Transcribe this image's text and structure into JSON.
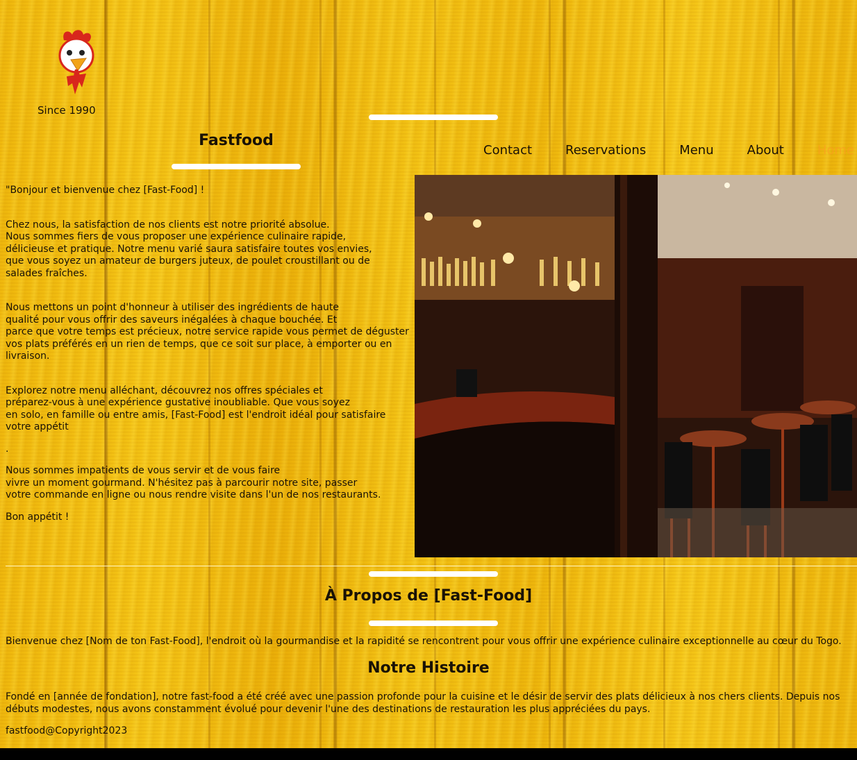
{
  "header": {
    "since": "Since 1990",
    "brand": "Fastfood"
  },
  "nav": {
    "items": [
      "Contact",
      "Reservations",
      "Menu",
      "About",
      "Home"
    ]
  },
  "intro": {
    "p1": "\"Bonjour et bienvenue chez [Fast-Food] !",
    "p2_l1": "Chez nous, la satisfaction de nos clients est notre priorité absolue.",
    "p2_l2": "Nous sommes fiers de vous proposer une expérience culinaire rapide,",
    "p2_l3": "délicieuse et pratique. Notre menu varié saura satisfaire toutes vos envies,",
    "p2_l4": "que vous soyez un amateur de burgers juteux, de poulet croustillant ou de",
    "p2_l5": "salades fraîches.",
    "p3_l1": "Nous mettons un point d'honneur à utiliser des ingrédients de haute",
    "p3_l2": "qualité pour vous offrir des saveurs inégalées à chaque bouchée. Et",
    "p3_l3": "parce que votre temps est précieux, notre service rapide vous permet de déguster",
    "p3_l4": "vos plats préférés en un rien de temps, que ce soit sur place, à emporter ou en",
    "p3_l5": "livraison.",
    "p4_l1": "Explorez notre menu alléchant, découvrez nos offres spéciales et",
    "p4_l2": "préparez-vous à une expérience gustative inoubliable. Que vous soyez",
    "p4_l3": "en solo, en famille ou entre amis, [Fast-Food] est l'endroit idéal pour satisfaire",
    "p4_l4": "votre appétit",
    "dot": ".",
    "p5_l1": "Nous sommes impatients de vous servir et de vous faire",
    "p5_l2": "vivre un moment gourmand. N'hésitez pas à parcourir notre site, passer",
    "p5_l3": "votre commande en ligne ou nous rendre visite dans l'un de nos restaurants.",
    "p6": "Bon appétit !"
  },
  "about": {
    "title": "À Propos de [Fast-Food]",
    "text": "Bienvenue chez [Nom de ton Fast-Food], l'endroit où la gourmandise et la rapidité se rencontrent pour vous offrir une expérience culinaire exceptionnelle au cœur du Togo."
  },
  "story": {
    "title": "Notre Histoire",
    "l1": "Fondé en [année de fondation], notre fast-food a été créé avec une passion profonde pour la cuisine et le désir de servir des plats délicieux à nos chers clients. Depuis nos",
    "l2": "débuts modestes, nous avons constamment évolué pour devenir l'une des destinations de restauration les plus appréciées du pays."
  },
  "footer": {
    "copyright": "fastfood@Copyright2023"
  },
  "colors": {
    "background": "#f3bd0f",
    "accent_bar": "#ffffff",
    "home_link": "#ff9a22"
  },
  "icons": {
    "logo": "rooster-mascot"
  }
}
